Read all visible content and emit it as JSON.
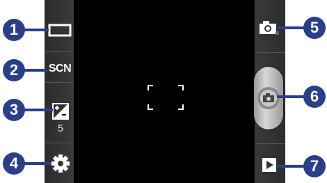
{
  "left_panel": {
    "display_mode": {
      "icon": "display-mode-icon"
    },
    "scene_mode": {
      "label": "SCN"
    },
    "exposure": {
      "icon": "exposure-icon",
      "value": "5"
    },
    "settings": {
      "icon": "gear-icon"
    }
  },
  "right_panel": {
    "mode_switch": {
      "icon": "camera-icon"
    },
    "shutter": {
      "icon": "camera-shutter-icon"
    },
    "gallery": {
      "icon": "play-icon"
    }
  },
  "callouts": [
    "1",
    "2",
    "3",
    "4",
    "5",
    "6",
    "7"
  ],
  "colors": {
    "callout": "#2b3e8c",
    "panel": "#333333",
    "preview": "#000000"
  }
}
